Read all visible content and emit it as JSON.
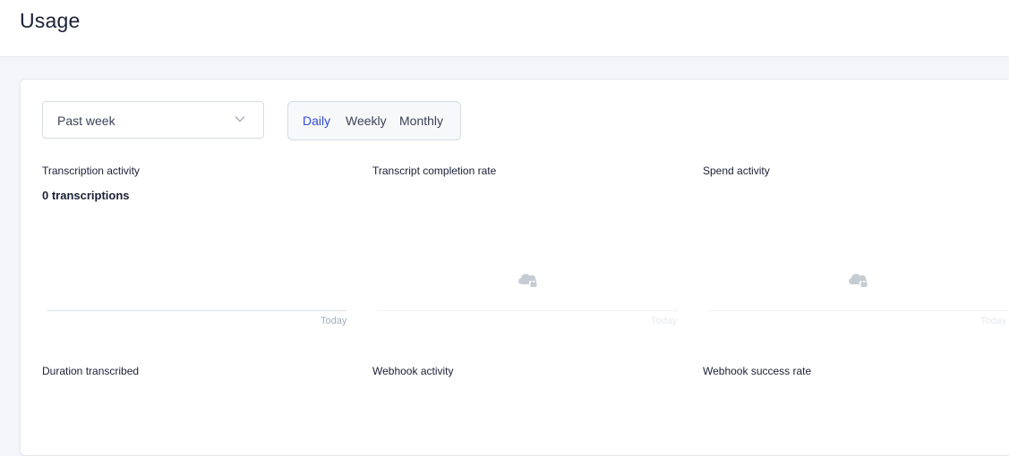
{
  "page": {
    "title": "Usage"
  },
  "filters": {
    "range_selected": "Past week",
    "granularity": [
      "Daily",
      "Weekly",
      "Monthly"
    ],
    "granularity_active": "Daily"
  },
  "panels": {
    "transcription_activity": {
      "title": "Transcription activity",
      "metric": "0 transcriptions",
      "axis_label": "Today"
    },
    "completion_rate": {
      "title": "Transcript completion rate",
      "axis_label": "Today",
      "icon": "cloud-lock-icon"
    },
    "spend_activity": {
      "title": "Spend activity",
      "axis_label": "Today",
      "icon": "cloud-lock-icon"
    },
    "duration_transcribed": {
      "title": "Duration transcribed"
    },
    "webhook_activity": {
      "title": "Webhook activity"
    },
    "webhook_success_rate": {
      "title": "Webhook success rate"
    }
  },
  "colors": {
    "accent": "#2e4bd6",
    "background": "#f3f5f8",
    "border": "#e3e8ee"
  }
}
